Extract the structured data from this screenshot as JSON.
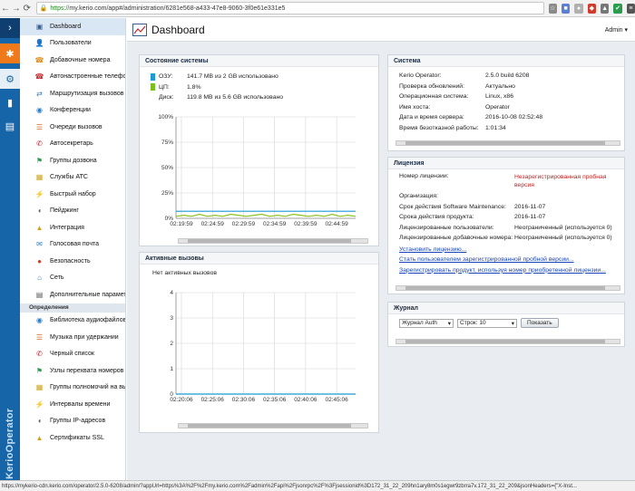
{
  "browser": {
    "url_scheme": "https://",
    "url_rest": "my.kerio.com/app#/administration/6281e568-a433-47e8-9060-3f0e61e331e5",
    "extensions": [
      "ext-a",
      "ext-b",
      "ext-c",
      "ext-d",
      "ext-e",
      "ext-f",
      "ext-g"
    ]
  },
  "rail": {
    "brand": "KerioOperator",
    "icons": [
      "chevron-right-icon",
      "plus-icon",
      "gear-icon",
      "bar-chart-icon",
      "document-icon"
    ]
  },
  "nav": {
    "items": [
      {
        "label": "Dashboard",
        "icon": "dashboard-icon",
        "active": true
      },
      {
        "label": "Пользователи",
        "icon": "users-icon"
      },
      {
        "label": "Добавочные номера",
        "icon": "phone-extension-icon"
      },
      {
        "label": "Автонастроенные телефоны",
        "icon": "phone-icon"
      },
      {
        "label": "Маршрутизация вызовов",
        "icon": "routing-icon"
      },
      {
        "label": "Конференции",
        "icon": "conference-icon"
      },
      {
        "label": "Очереди вызовов",
        "icon": "queue-icon"
      },
      {
        "label": "Автосекретарь",
        "icon": "auto-attendant-icon"
      },
      {
        "label": "Группы дозвона",
        "icon": "ring-group-icon"
      },
      {
        "label": "Службы АТС",
        "icon": "pbx-services-icon"
      },
      {
        "label": "Быстрый набор",
        "icon": "speed-dial-icon"
      },
      {
        "label": "Пейджинг",
        "icon": "paging-icon"
      },
      {
        "label": "Интеграция",
        "icon": "integration-icon"
      },
      {
        "label": "Голосовая почта",
        "icon": "voicemail-icon"
      },
      {
        "label": "Безопасность",
        "icon": "security-icon"
      },
      {
        "label": "Сеть",
        "icon": "network-icon"
      },
      {
        "label": "Дополнительные параметры",
        "icon": "advanced-icon"
      }
    ],
    "section2_title": "Определения",
    "items2": [
      {
        "label": "Библиотека аудиофайлов",
        "icon": "audio-library-icon"
      },
      {
        "label": "Музыка при удержании",
        "icon": "music-on-hold-icon"
      },
      {
        "label": "Черный список",
        "icon": "blacklist-icon"
      },
      {
        "label": "Узлы перехвата номеров",
        "icon": "call-pickup-icon"
      },
      {
        "label": "Группы полномочий на вызовы",
        "icon": "call-permissions-icon"
      },
      {
        "label": "Интервалы времени",
        "icon": "time-intervals-icon"
      },
      {
        "label": "Группы IP-адресов",
        "icon": "ip-groups-icon"
      },
      {
        "label": "Сертификаты SSL",
        "icon": "ssl-certificates-icon"
      }
    ]
  },
  "header": {
    "title": "Dashboard",
    "admin": "Admin ▾"
  },
  "system_status": {
    "title": "Состояние системы",
    "rows": [
      {
        "label": "ОЗУ:",
        "value": "141.7 MB из 2 GB использовано",
        "color": "#1a9ad6"
      },
      {
        "label": "ЦП:",
        "value": "1.8%",
        "color": "#7bbf1e"
      },
      {
        "label": "Диск:",
        "value": "119.8 MB из 5.6 GB использовано",
        "color": ""
      }
    ]
  },
  "active_calls": {
    "title": "Активные вызовы",
    "empty": "Нет активных вызовов"
  },
  "system": {
    "title": "Система",
    "rows": [
      {
        "label": "Kerio Operator:",
        "value": "2.5.0 build 6208"
      },
      {
        "label": "Проверка обновлений:",
        "value": "Актуально"
      },
      {
        "label": "Операционная система:",
        "value": "Linux, x86"
      },
      {
        "label": "Имя хоста:",
        "value": "Operator"
      },
      {
        "label": "Дата и время сервера:",
        "value": "2016-10-08 02:52:48"
      },
      {
        "label": "Время безотказной работы:",
        "value": "1:01:34"
      }
    ]
  },
  "license": {
    "title": "Лицензия",
    "rows": [
      {
        "label": "Номер лицензии:",
        "value": "Незарегистрированная пробная версия",
        "red": true
      },
      {
        "label": "Организация:",
        "value": ""
      },
      {
        "label": "Срок действия Software Maintenance:",
        "value": "2016-11-07"
      },
      {
        "label": "Срока действия продукта:",
        "value": "2016-11-07"
      },
      {
        "label": "Лицензированные пользователи:",
        "value": "Неограниченный (используется 0)"
      },
      {
        "label": "Лицензированные добавочные номера:",
        "value": "Неограниченный (используется 0)"
      }
    ],
    "links": [
      "Установить лицензию...",
      "Стать пользователем зарегистрированной пробной версии...",
      "Зарегистрировать продукт, используя номер приобретенной лицензии..."
    ]
  },
  "journal": {
    "title": "Журнал",
    "log_select": "Журнал Auth",
    "rows_select": "Строк: 10",
    "show_button": "Показать"
  },
  "statusbar": {
    "text": "https://mykerio-cdn.kerio.com/operator/2.5.0-6208/admin/?appUrl=https%3A%2F%2Fmy.kerio.com%2Fadmin%2Fapi%2Fjsonrpc%2F%3Fjsessionid%3D172_31_22_209hn1ary8m0s1egwr9zbrra7v.172_31_22_209&jsonHeaders={\"X-Inst..."
  },
  "chart_data": [
    {
      "type": "line",
      "title": "",
      "x": [
        "02:19:59",
        "02:24:59",
        "02:29:59",
        "02:34:59",
        "02:39:59",
        "02:44:59"
      ],
      "ylabel": "",
      "xlabel": "",
      "y_ticks": [
        "0%",
        "25%",
        "50%",
        "75%",
        "100%"
      ],
      "ylim": [
        0,
        100
      ],
      "series": [
        {
          "name": "ОЗУ",
          "color": "#1a9ad6",
          "values": [
            7,
            7,
            7,
            7,
            7,
            7,
            7,
            7,
            7,
            7,
            7,
            7,
            7,
            7,
            7,
            7,
            7,
            7,
            7,
            7,
            7,
            7,
            7,
            7
          ]
        },
        {
          "name": "ЦП",
          "color": "#8cc21f",
          "values": [
            2,
            3,
            2,
            4,
            2,
            3,
            2,
            4,
            3,
            2,
            3,
            4,
            2,
            3,
            2,
            4,
            3,
            2,
            3,
            2,
            4,
            2,
            3,
            2
          ]
        }
      ],
      "grid": true
    },
    {
      "type": "line",
      "title": "",
      "x": [
        "02:20:06",
        "02:25:06",
        "02:30:06",
        "02:35:06",
        "02:40:06",
        "02:45:06"
      ],
      "y_ticks": [
        "0",
        "1",
        "2",
        "3",
        "4"
      ],
      "ylim": [
        0,
        4
      ],
      "series": [
        {
          "color": "#1a9ad6",
          "values": [
            0,
            0,
            0,
            0,
            0,
            0
          ]
        }
      ],
      "grid": true
    }
  ]
}
